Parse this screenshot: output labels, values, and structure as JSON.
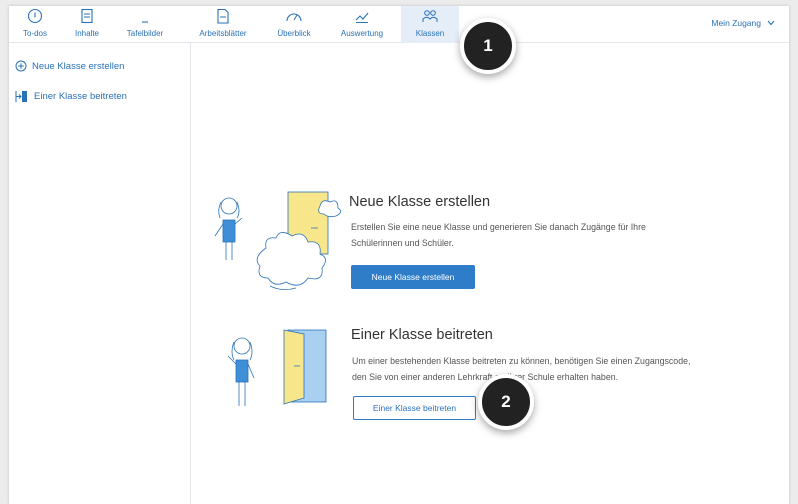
{
  "nav": {
    "items": [
      {
        "label": "To-dos",
        "icon": "todo-icon"
      },
      {
        "label": "Inhalte",
        "icon": "content-icon"
      },
      {
        "label": "Tafelbilder",
        "icon": "board-icon"
      },
      {
        "label": "Arbeitsblätter",
        "icon": "worksheet-icon"
      },
      {
        "label": "Überblick",
        "icon": "gauge-icon"
      },
      {
        "label": "Auswertung",
        "icon": "chart-icon"
      },
      {
        "label": "Klassen",
        "icon": "classes-icon"
      }
    ],
    "active": "Klassen",
    "account_label": "Mein Zugang"
  },
  "sidebar": {
    "items": [
      {
        "label": "Neue Klasse erstellen",
        "icon": "plus-circle-icon"
      },
      {
        "label": "Einer Klasse beitreten",
        "icon": "door-enter-icon"
      }
    ]
  },
  "main": {
    "create": {
      "title": "Neue Klasse erstellen",
      "desc_line1": "Erstellen Sie eine neue Klasse und generieren Sie danach Zugänge für Ihre",
      "desc_line2": "Schülerinnen und Schüler.",
      "button": "Neue Klasse erstellen"
    },
    "join": {
      "title": "Einer Klasse beitreten",
      "desc_line1": "Um einer bestehenden Klasse beitreten zu können, benötigen Sie einen Zugangscode,",
      "desc_line2": "den Sie von einer anderen Lehrkraft an Ihrer Schule erhalten haben.",
      "button": "Einer Klasse beitreten"
    }
  },
  "badges": {
    "one": "1",
    "two": "2"
  },
  "colors": {
    "accent": "#2a72b8",
    "button": "#2f7dc9",
    "door_yellow": "#f8e78a",
    "door_blue": "#a9d0f0",
    "badge": "#222222"
  }
}
